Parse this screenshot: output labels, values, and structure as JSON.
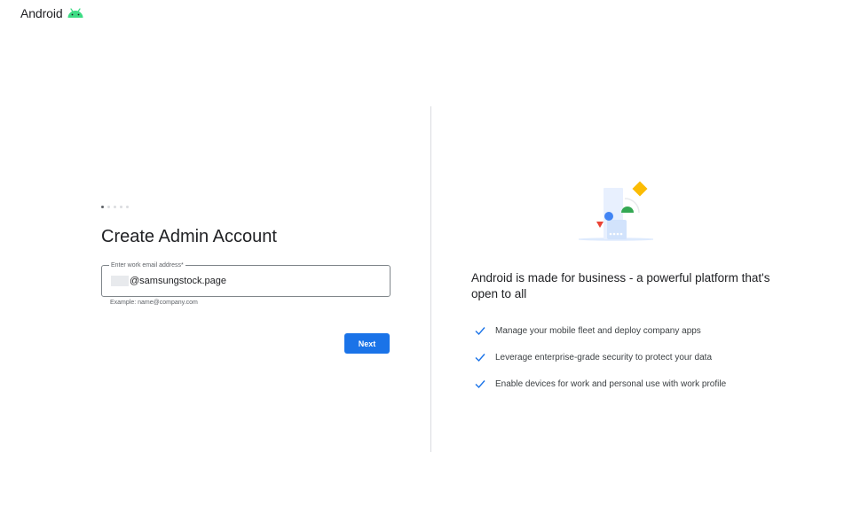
{
  "brand": {
    "name": "Android",
    "logo_icon": "android-bot-icon",
    "logo_color": "#3ddc84"
  },
  "progress": {
    "total_steps": 5,
    "current_step": 1
  },
  "form": {
    "title": "Create Admin Account",
    "email_label": "Enter work email address*",
    "email_value": "@samsungstock.page",
    "email_helper": "Example: name@company.com",
    "next_label": "Next"
  },
  "promo": {
    "heading": "Android is made for business - a powerful platform that's open to all",
    "features": [
      {
        "icon": "check-icon",
        "text": "Manage your mobile fleet and deploy company apps"
      },
      {
        "icon": "check-icon",
        "text": "Leverage enterprise-grade security to protect your data"
      },
      {
        "icon": "check-icon",
        "text": "Enable devices for work and personal use with work profile"
      }
    ]
  },
  "colors": {
    "primary": "#1a73e8",
    "check": "#1a73e8",
    "illustration_yellow": "#fbbc04",
    "illustration_green": "#34a853",
    "illustration_blue": "#4285f4",
    "illustration_red": "#ea4335"
  }
}
